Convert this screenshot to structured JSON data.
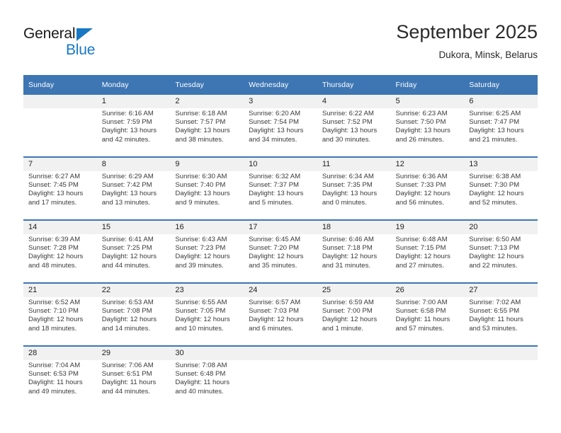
{
  "brand": {
    "name_primary": "General",
    "name_secondary": "Blue",
    "triangle_color": "#1878c4"
  },
  "header": {
    "month_title": "September 2025",
    "location": "Dukora, Minsk, Belarus"
  },
  "theme": {
    "header_blue": "#3d76b3",
    "daynum_band": "#f1f1f1",
    "text": "#3a3a3a"
  },
  "weekday_headers": [
    "Sunday",
    "Monday",
    "Tuesday",
    "Wednesday",
    "Thursday",
    "Friday",
    "Saturday"
  ],
  "weeks": [
    [
      {
        "day": "",
        "sunrise": "",
        "sunset": "",
        "daylight_1": "",
        "daylight_2": ""
      },
      {
        "day": "1",
        "sunrise": "Sunrise: 6:16 AM",
        "sunset": "Sunset: 7:59 PM",
        "daylight_1": "Daylight: 13 hours",
        "daylight_2": "and 42 minutes."
      },
      {
        "day": "2",
        "sunrise": "Sunrise: 6:18 AM",
        "sunset": "Sunset: 7:57 PM",
        "daylight_1": "Daylight: 13 hours",
        "daylight_2": "and 38 minutes."
      },
      {
        "day": "3",
        "sunrise": "Sunrise: 6:20 AM",
        "sunset": "Sunset: 7:54 PM",
        "daylight_1": "Daylight: 13 hours",
        "daylight_2": "and 34 minutes."
      },
      {
        "day": "4",
        "sunrise": "Sunrise: 6:22 AM",
        "sunset": "Sunset: 7:52 PM",
        "daylight_1": "Daylight: 13 hours",
        "daylight_2": "and 30 minutes."
      },
      {
        "day": "5",
        "sunrise": "Sunrise: 6:23 AM",
        "sunset": "Sunset: 7:50 PM",
        "daylight_1": "Daylight: 13 hours",
        "daylight_2": "and 26 minutes."
      },
      {
        "day": "6",
        "sunrise": "Sunrise: 6:25 AM",
        "sunset": "Sunset: 7:47 PM",
        "daylight_1": "Daylight: 13 hours",
        "daylight_2": "and 21 minutes."
      }
    ],
    [
      {
        "day": "7",
        "sunrise": "Sunrise: 6:27 AM",
        "sunset": "Sunset: 7:45 PM",
        "daylight_1": "Daylight: 13 hours",
        "daylight_2": "and 17 minutes."
      },
      {
        "day": "8",
        "sunrise": "Sunrise: 6:29 AM",
        "sunset": "Sunset: 7:42 PM",
        "daylight_1": "Daylight: 13 hours",
        "daylight_2": "and 13 minutes."
      },
      {
        "day": "9",
        "sunrise": "Sunrise: 6:30 AM",
        "sunset": "Sunset: 7:40 PM",
        "daylight_1": "Daylight: 13 hours",
        "daylight_2": "and 9 minutes."
      },
      {
        "day": "10",
        "sunrise": "Sunrise: 6:32 AM",
        "sunset": "Sunset: 7:37 PM",
        "daylight_1": "Daylight: 13 hours",
        "daylight_2": "and 5 minutes."
      },
      {
        "day": "11",
        "sunrise": "Sunrise: 6:34 AM",
        "sunset": "Sunset: 7:35 PM",
        "daylight_1": "Daylight: 13 hours",
        "daylight_2": "and 0 minutes."
      },
      {
        "day": "12",
        "sunrise": "Sunrise: 6:36 AM",
        "sunset": "Sunset: 7:33 PM",
        "daylight_1": "Daylight: 12 hours",
        "daylight_2": "and 56 minutes."
      },
      {
        "day": "13",
        "sunrise": "Sunrise: 6:38 AM",
        "sunset": "Sunset: 7:30 PM",
        "daylight_1": "Daylight: 12 hours",
        "daylight_2": "and 52 minutes."
      }
    ],
    [
      {
        "day": "14",
        "sunrise": "Sunrise: 6:39 AM",
        "sunset": "Sunset: 7:28 PM",
        "daylight_1": "Daylight: 12 hours",
        "daylight_2": "and 48 minutes."
      },
      {
        "day": "15",
        "sunrise": "Sunrise: 6:41 AM",
        "sunset": "Sunset: 7:25 PM",
        "daylight_1": "Daylight: 12 hours",
        "daylight_2": "and 44 minutes."
      },
      {
        "day": "16",
        "sunrise": "Sunrise: 6:43 AM",
        "sunset": "Sunset: 7:23 PM",
        "daylight_1": "Daylight: 12 hours",
        "daylight_2": "and 39 minutes."
      },
      {
        "day": "17",
        "sunrise": "Sunrise: 6:45 AM",
        "sunset": "Sunset: 7:20 PM",
        "daylight_1": "Daylight: 12 hours",
        "daylight_2": "and 35 minutes."
      },
      {
        "day": "18",
        "sunrise": "Sunrise: 6:46 AM",
        "sunset": "Sunset: 7:18 PM",
        "daylight_1": "Daylight: 12 hours",
        "daylight_2": "and 31 minutes."
      },
      {
        "day": "19",
        "sunrise": "Sunrise: 6:48 AM",
        "sunset": "Sunset: 7:15 PM",
        "daylight_1": "Daylight: 12 hours",
        "daylight_2": "and 27 minutes."
      },
      {
        "day": "20",
        "sunrise": "Sunrise: 6:50 AM",
        "sunset": "Sunset: 7:13 PM",
        "daylight_1": "Daylight: 12 hours",
        "daylight_2": "and 22 minutes."
      }
    ],
    [
      {
        "day": "21",
        "sunrise": "Sunrise: 6:52 AM",
        "sunset": "Sunset: 7:10 PM",
        "daylight_1": "Daylight: 12 hours",
        "daylight_2": "and 18 minutes."
      },
      {
        "day": "22",
        "sunrise": "Sunrise: 6:53 AM",
        "sunset": "Sunset: 7:08 PM",
        "daylight_1": "Daylight: 12 hours",
        "daylight_2": "and 14 minutes."
      },
      {
        "day": "23",
        "sunrise": "Sunrise: 6:55 AM",
        "sunset": "Sunset: 7:05 PM",
        "daylight_1": "Daylight: 12 hours",
        "daylight_2": "and 10 minutes."
      },
      {
        "day": "24",
        "sunrise": "Sunrise: 6:57 AM",
        "sunset": "Sunset: 7:03 PM",
        "daylight_1": "Daylight: 12 hours",
        "daylight_2": "and 6 minutes."
      },
      {
        "day": "25",
        "sunrise": "Sunrise: 6:59 AM",
        "sunset": "Sunset: 7:00 PM",
        "daylight_1": "Daylight: 12 hours",
        "daylight_2": "and 1 minute."
      },
      {
        "day": "26",
        "sunrise": "Sunrise: 7:00 AM",
        "sunset": "Sunset: 6:58 PM",
        "daylight_1": "Daylight: 11 hours",
        "daylight_2": "and 57 minutes."
      },
      {
        "day": "27",
        "sunrise": "Sunrise: 7:02 AM",
        "sunset": "Sunset: 6:55 PM",
        "daylight_1": "Daylight: 11 hours",
        "daylight_2": "and 53 minutes."
      }
    ],
    [
      {
        "day": "28",
        "sunrise": "Sunrise: 7:04 AM",
        "sunset": "Sunset: 6:53 PM",
        "daylight_1": "Daylight: 11 hours",
        "daylight_2": "and 49 minutes."
      },
      {
        "day": "29",
        "sunrise": "Sunrise: 7:06 AM",
        "sunset": "Sunset: 6:51 PM",
        "daylight_1": "Daylight: 11 hours",
        "daylight_2": "and 44 minutes."
      },
      {
        "day": "30",
        "sunrise": "Sunrise: 7:08 AM",
        "sunset": "Sunset: 6:48 PM",
        "daylight_1": "Daylight: 11 hours",
        "daylight_2": "and 40 minutes."
      },
      {
        "day": "",
        "sunrise": "",
        "sunset": "",
        "daylight_1": "",
        "daylight_2": ""
      },
      {
        "day": "",
        "sunrise": "",
        "sunset": "",
        "daylight_1": "",
        "daylight_2": ""
      },
      {
        "day": "",
        "sunrise": "",
        "sunset": "",
        "daylight_1": "",
        "daylight_2": ""
      },
      {
        "day": "",
        "sunrise": "",
        "sunset": "",
        "daylight_1": "",
        "daylight_2": ""
      }
    ]
  ]
}
